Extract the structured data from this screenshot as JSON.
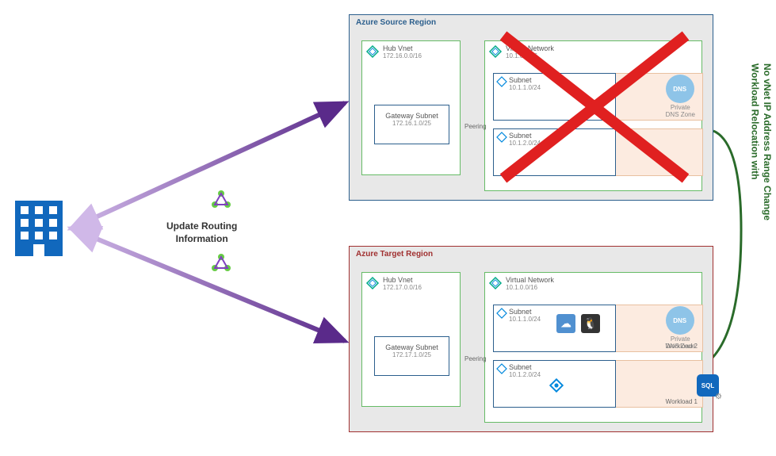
{
  "diagram_title": "Workload Relocation with No vNet IP Address Range Change",
  "source_region": {
    "title": "Azure Source Region",
    "hub_vnet": {
      "title": "Hub Vnet",
      "cidr": "172.16.0.0/16"
    },
    "gateway_subnet": {
      "title": "Gateway Subnet",
      "cidr": "172.16.1.0/25"
    },
    "spoke_vnet": {
      "title": "Virtual Network",
      "cidr": "10.1.0.0/16"
    },
    "subnet1": {
      "title": "Subnet",
      "cidr": "10.1.1.0/24"
    },
    "subnet2": {
      "title": "Subnet",
      "cidr": "10.1.2.0/24"
    },
    "dns": {
      "label": "Private\nDNS Zone",
      "badge": "DNS"
    },
    "peering": "Peering",
    "disabled": true
  },
  "target_region": {
    "title": "Azure Target Region",
    "hub_vnet": {
      "title": "Hub Vnet",
      "cidr": "172.17.0.0/16"
    },
    "gateway_subnet": {
      "title": "Gateway Subnet",
      "cidr": "172.17.1.0/25"
    },
    "spoke_vnet": {
      "title": "Virtual Network",
      "cidr": "10.1.0.0/16"
    },
    "subnet1": {
      "title": "Subnet",
      "cidr": "10.1.1.0/24"
    },
    "subnet2": {
      "title": "Subnet",
      "cidr": "10.1.2.0/24"
    },
    "workload1": "Workload 1",
    "workload2": "Workload 2",
    "dns": {
      "label": "Private\nDNS Zone",
      "badge": "DNS"
    },
    "sql": "SQL",
    "peering": "Peering"
  },
  "routing": {
    "line1": "Update Routing",
    "line2": "Information"
  },
  "relocation_arrow": {
    "line1": "Workload Relocation with",
    "line2": "No vNet IP Address Range Change"
  },
  "onprem": "Corporate Datacenter"
}
